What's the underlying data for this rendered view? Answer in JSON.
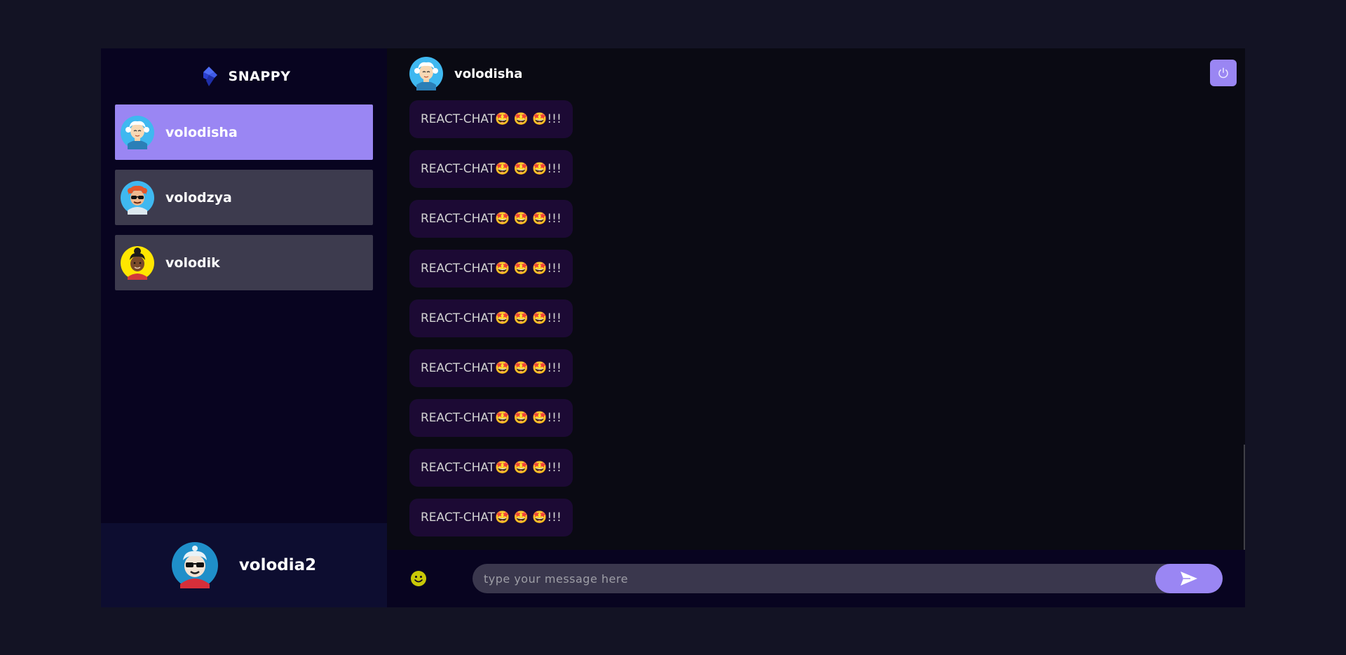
{
  "brand": {
    "name": "SNAPPY",
    "logo_icon": "snappy-logo-icon"
  },
  "contacts": [
    {
      "name": "volodisha",
      "selected": true,
      "avatar_icon": "blonde-avatar-icon"
    },
    {
      "name": "volodzya",
      "selected": false,
      "avatar_icon": "redhead-sunglasses-avatar-icon"
    },
    {
      "name": "volodik",
      "selected": false,
      "avatar_icon": "dark-hair-avatar-icon"
    }
  ],
  "current_user": {
    "name": "volodia2",
    "avatar_icon": "cool-sunglasses-avatar-icon"
  },
  "chat": {
    "header_name": "volodisha",
    "logout_icon": "power-icon",
    "messages": [
      "REACT-CHAT🤩 🤩 🤩!!!",
      "REACT-CHAT🤩 🤩 🤩!!!",
      "REACT-CHAT🤩 🤩 🤩!!!",
      "REACT-CHAT🤩 🤩 🤩!!!",
      "REACT-CHAT🤩 🤩 🤩!!!",
      "REACT-CHAT🤩 🤩 🤩!!!",
      "REACT-CHAT🤩 🤩 🤩!!!",
      "REACT-CHAT🤩 🤩 🤩!!!",
      "REACT-CHAT🤩 🤩 🤩!!!"
    ],
    "input_placeholder": "type your message here",
    "input_value": "",
    "emoji_icon": "smiley-icon",
    "send_icon": "send-icon"
  },
  "colors": {
    "accent": "#9a86f3",
    "contact_bg": "#3d3b4e",
    "message_bg": "#1c0a34",
    "emoji_yellow": "#ffff00c8"
  }
}
